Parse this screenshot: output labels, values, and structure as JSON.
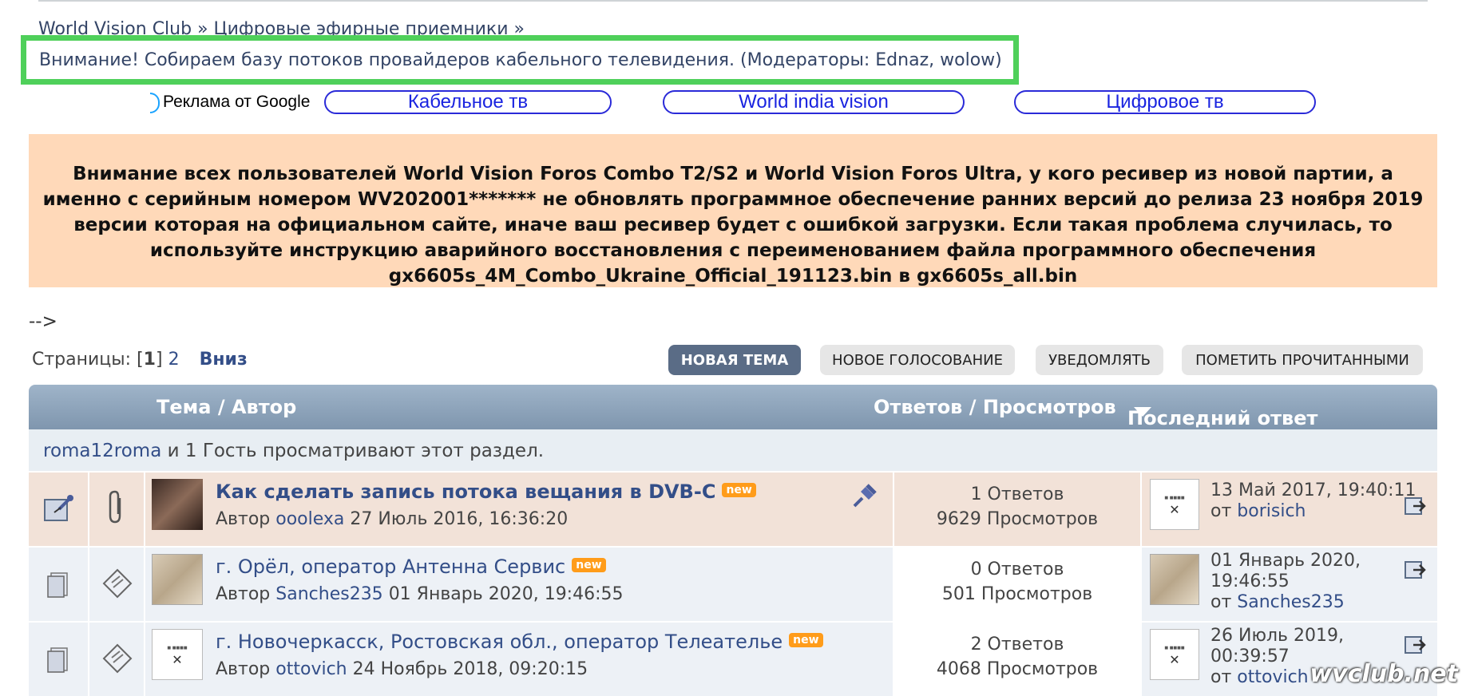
{
  "breadcrumb": {
    "site": "World Vision Club",
    "sep1": "»",
    "section": "Цифровые эфирные приемники",
    "sep2": "»"
  },
  "notice": {
    "text": "Внимание! Собираем базу потоков провайдеров кабельного телевидения.",
    "moderators_prefix": "(Модераторы:",
    "moderator1": "Ednaz",
    "moderator2": "wolow",
    "moderators_suffix": ")"
  },
  "ads": {
    "label": "Реклама от Google",
    "links": [
      "Кабельное тв",
      "World india vision",
      "Цифровое тв"
    ]
  },
  "announcement": "Внимание всех пользователей World Vision Foros Combo T2/S2 и World Vision Foros Ultra, у кого ресивер из новой партии, а именно с серийным номером WV202001******* не обновлять программное обеспечение ранних версий до релиза 23 ноября 2019 версии которая на официальном сайте, иначе ваш ресивер будет с ошибкой загрузки. Если такая проблема случилась, то используйте инструкцию аварийного восстановления с переименованием файла программного обеспечения gx6605s_4M_Combo_Ukraine_Official_191123.bin в gx6605s_all.bin",
  "stray_text": "-->",
  "pagination": {
    "label": "Страницы:",
    "open": "[",
    "current": "1",
    "close": "]",
    "page2": "2",
    "down": "Вниз"
  },
  "buttons": {
    "new_topic": "НОВАЯ ТЕМА",
    "new_poll": "НОВОЕ ГОЛОСОВАНИЕ",
    "notify": "УВЕДОМЛЯТЬ",
    "mark_read": "ПОМЕТИТЬ ПРОЧИТАННЫМИ"
  },
  "table": {
    "col_topic": "Тема / Автор",
    "col_stats": "Ответов / Просмотров",
    "col_last": "Последний ответ"
  },
  "viewing": {
    "user": "roma12roma",
    "rest": "и 1 Гость просматривают этот раздел."
  },
  "topics": [
    {
      "title": "Как сделать запись потока вещания в DVB-C",
      "badge": "new",
      "author_prefix": "Автор",
      "author": "ooolexa",
      "date": "27 Июль 2016, 16:36:20",
      "replies": "1 Ответов",
      "views": "9629 Просмотров",
      "last_date": "13 Май 2017, 19:40:11",
      "last_by_prefix": "от",
      "last_by": "borisich"
    },
    {
      "title": "г. Орёл, оператор Антенна Сервис",
      "badge": "new",
      "author_prefix": "Автор",
      "author": "Sanches235",
      "date": "01 Январь 2020, 19:46:55",
      "replies": "0 Ответов",
      "views": "501 Просмотров",
      "last_date_1": "01 Январь 2020,",
      "last_date_2": "19:46:55",
      "last_by_prefix": "от",
      "last_by": "Sanches235"
    },
    {
      "title": "г. Новочеркасск, Ростовская обл., оператор Телеательe",
      "badge": "new",
      "author_prefix": "Автор",
      "author": "ottovich",
      "date": "24 Ноябрь 2018, 09:20:15",
      "replies": "2 Ответов",
      "views": "4068 Просмотров",
      "last_date_1": "26 Июль 2019,",
      "last_date_2": "00:39:57",
      "last_by_prefix": "от",
      "last_by": "ottovich"
    }
  ],
  "watermark": "wvclub.net",
  "colors": {
    "notice_border": "#4fd05a",
    "announcement_bg": "#ffd9b9",
    "header_bg": "#8ca3bb",
    "badge_new": "#ff9c1a",
    "primary_button": "#5a6c86",
    "link": "#334e88"
  }
}
